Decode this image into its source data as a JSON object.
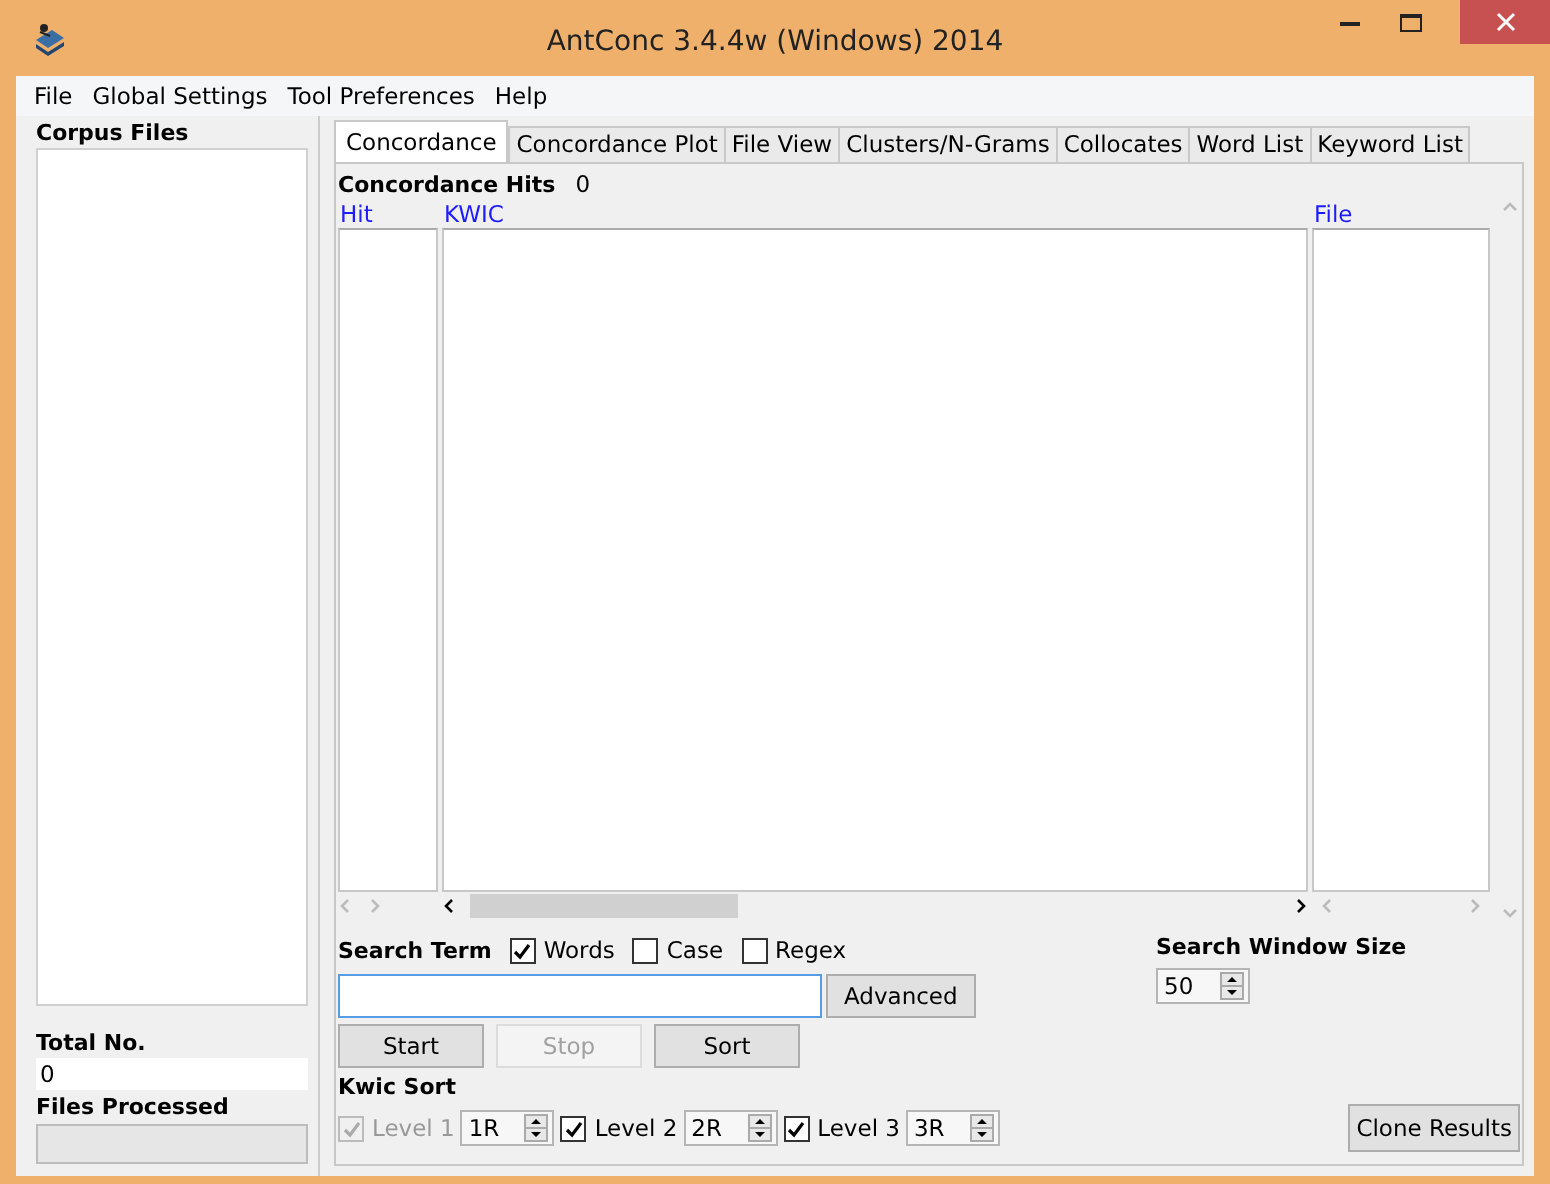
{
  "window": {
    "title": "AntConc 3.4.4w (Windows) 2014"
  },
  "menu": [
    "File",
    "Global Settings",
    "Tool Preferences",
    "Help"
  ],
  "sidebar": {
    "corpus_files_label": "Corpus Files",
    "total_label": "Total No.",
    "total_value": "0",
    "processed_label": "Files Processed",
    "progress": {
      "level": 0
    }
  },
  "tabs": [
    {
      "label": "Concordance",
      "selected": true
    },
    {
      "label": "Concordance Plot",
      "selected": false
    },
    {
      "label": "File View",
      "selected": false
    },
    {
      "label": "Clusters/N-Grams",
      "selected": false
    },
    {
      "label": "Collocates",
      "selected": false
    },
    {
      "label": "Word List",
      "selected": false
    },
    {
      "label": "Keyword List",
      "selected": false
    }
  ],
  "hits": {
    "label": "Concordance Hits",
    "value": "0"
  },
  "columns": [
    "Hit",
    "KWIC",
    "File"
  ],
  "search": {
    "label": "Search Term",
    "options": [
      {
        "label": "Words",
        "checked": true
      },
      {
        "label": "Case",
        "checked": false
      },
      {
        "label": "Regex",
        "checked": false
      }
    ]
  },
  "advanced_button": "Advanced",
  "actions": [
    {
      "label": "Start",
      "disabled": false
    },
    {
      "label": "Stop",
      "disabled": true
    },
    {
      "label": "Sort",
      "disabled": false
    }
  ],
  "window_size": {
    "label": "Search Window Size",
    "value": "50"
  },
  "kwic_sort": {
    "label": "Kwic Sort",
    "levels": [
      {
        "label": "Level 1",
        "checked": true,
        "disabled": true,
        "value": "1R"
      },
      {
        "label": "Level 2",
        "checked": true,
        "disabled": false,
        "value": "2R"
      },
      {
        "label": "Level 3",
        "checked": true,
        "disabled": false,
        "value": "3R"
      }
    ]
  },
  "clone_button": "Clone Results"
}
